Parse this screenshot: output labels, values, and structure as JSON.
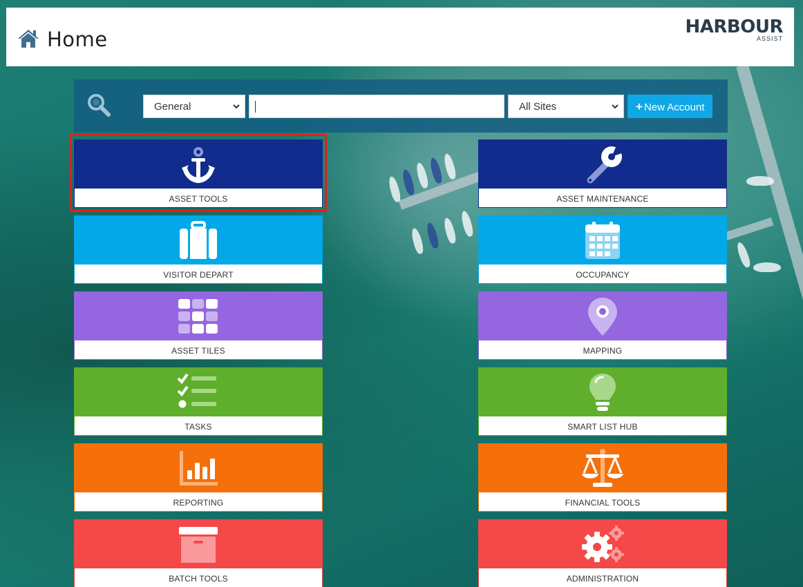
{
  "header": {
    "title": "Home",
    "logo_main": "HARBOUR",
    "logo_sub": "ASSIST"
  },
  "search": {
    "category_selected": "General",
    "query": "",
    "site_selected": "All Sites",
    "new_account_label": "New Account"
  },
  "tiles": [
    {
      "label": "ASSET TOOLS",
      "icon": "anchor-icon",
      "color": "#112c8c",
      "selected": true
    },
    {
      "label": "ASSET MAINTENANCE",
      "icon": "wrench-icon",
      "color": "#112c8c"
    },
    {
      "label": "VISITOR DEPART",
      "icon": "luggage-icon",
      "color": "#03a8e8"
    },
    {
      "label": "OCCUPANCY",
      "icon": "calendar-icon",
      "color": "#03a8e8"
    },
    {
      "label": "ASSET TILES",
      "icon": "tiles-grid-icon",
      "color": "#9466e0"
    },
    {
      "label": "MAPPING",
      "icon": "map-pin-icon",
      "color": "#9466e0"
    },
    {
      "label": "TASKS",
      "icon": "checklist-icon",
      "color": "#5faf2c"
    },
    {
      "label": "SMART LIST HUB",
      "icon": "lightbulb-icon",
      "color": "#5faf2c"
    },
    {
      "label": "REPORTING",
      "icon": "bar-chart-icon",
      "color": "#f5700a"
    },
    {
      "label": "FINANCIAL TOOLS",
      "icon": "scales-icon",
      "color": "#f5700a"
    },
    {
      "label": "BATCH TOOLS",
      "icon": "archive-box-icon",
      "color": "#f54848"
    },
    {
      "label": "ADMINISTRATION",
      "icon": "gears-icon",
      "color": "#f54848"
    }
  ]
}
